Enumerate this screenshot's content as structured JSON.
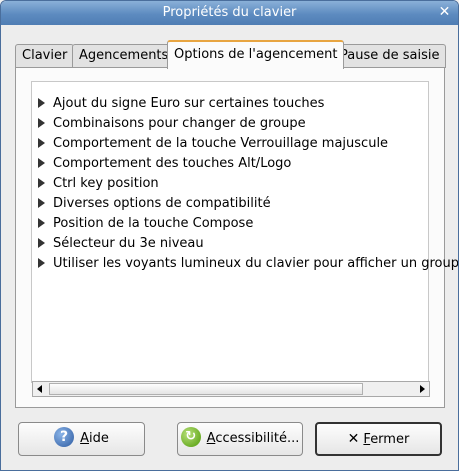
{
  "window": {
    "title": "Propriétés du clavier",
    "close_glyph": "✕"
  },
  "tabs": [
    {
      "label": "Clavier"
    },
    {
      "label": "Agencements"
    },
    {
      "label": "Options de l'agencement"
    },
    {
      "label": "Pause de saisie"
    }
  ],
  "options": [
    {
      "label": "Ajout du signe Euro sur certaines touches"
    },
    {
      "label": "Combinaisons pour changer de groupe"
    },
    {
      "label": "Comportement de la touche Verrouillage majuscule"
    },
    {
      "label": "Comportement des touches Alt/Logo"
    },
    {
      "label": "Ctrl key position"
    },
    {
      "label": "Diverses options de compatibilité"
    },
    {
      "label": "Position de la touche Compose"
    },
    {
      "label": "Sélecteur du 3e niveau"
    },
    {
      "label": "Utiliser les voyants lumineux du clavier pour afficher un groupe"
    }
  ],
  "buttons": {
    "help": {
      "mnemonic": "A",
      "rest": "ide",
      "icon": "help-icon"
    },
    "accessibility": {
      "mnemonic": "A",
      "rest": "ccessibilité...",
      "icon": "accessibility-icon"
    },
    "close": {
      "mnemonic": "F",
      "rest": "ermer",
      "icon": "close-icon"
    }
  }
}
